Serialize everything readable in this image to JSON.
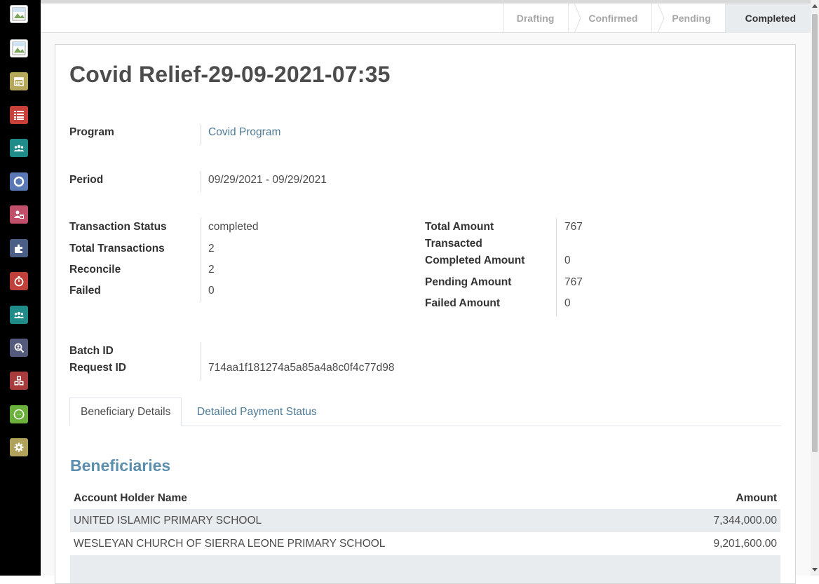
{
  "statusbar": {
    "stages": [
      "Drafting",
      "Confirmed",
      "Pending",
      "Completed"
    ],
    "active_stage": "Completed"
  },
  "sidebar": {
    "apps": [
      {
        "icon": "broken-image-icon",
        "color": "#ffffff"
      },
      {
        "icon": "broken-image-icon",
        "color": "#ffffff"
      },
      {
        "icon": "calendar-icon",
        "color": "#b6a85a"
      },
      {
        "icon": "list-icon",
        "color": "#c9403b"
      },
      {
        "icon": "users-icon",
        "color": "#1f8c8a"
      },
      {
        "icon": "lifebuoy-icon",
        "color": "#5a78b5"
      },
      {
        "icon": "user-calendar-icon",
        "color": "#c0506a"
      },
      {
        "icon": "puzzle-icon",
        "color": "#4b5f86"
      },
      {
        "icon": "stopwatch-icon",
        "color": "#c0403a"
      },
      {
        "icon": "users-icon",
        "color": "#1f8c8a"
      },
      {
        "icon": "search-user-icon",
        "color": "#545a7c"
      },
      {
        "icon": "cubes-icon",
        "color": "#a83b3b"
      },
      {
        "icon": "api-icon",
        "color": "#6ab03a"
      },
      {
        "icon": "gear-icon",
        "color": "#b0a25a"
      }
    ]
  },
  "record": {
    "title": "Covid Relief-29-09-2021-07:35",
    "program_label": "Program",
    "program_value": "Covid Program",
    "period_label": "Period",
    "period_value": "09/29/2021 - 09/29/2021",
    "left_fields": [
      {
        "label": "Transaction Status",
        "value": "completed"
      },
      {
        "label": "Total Transactions",
        "value": "2"
      },
      {
        "label": "Reconcile",
        "value": "2"
      },
      {
        "label": "Failed",
        "value": "0"
      }
    ],
    "right_fields": [
      {
        "label_line1": "Total Amount",
        "label_line2": "Transacted",
        "value": "767"
      },
      {
        "label": "Completed Amount",
        "value": "0"
      },
      {
        "label": "Pending Amount",
        "value": "767"
      },
      {
        "label": "Failed Amount",
        "value": "0"
      }
    ],
    "batch_id_label": "Batch ID",
    "batch_id_value": "",
    "request_id_label": "Request ID",
    "request_id_value": "714aa1f181274a5a85a4a8c0f4c77d98"
  },
  "tabs": [
    "Beneficiary Details",
    "Detailed Payment Status"
  ],
  "beneficiaries": {
    "title": "Beneficiaries",
    "columns": [
      "Account Holder Name",
      "Amount"
    ],
    "rows": [
      {
        "name": "UNITED ISLAMIC PRIMARY SCHOOL",
        "amount": "7,344,000.00"
      },
      {
        "name": "WESLEYAN CHURCH OF SIERRA LEONE PRIMARY SCHOOL",
        "amount": "9,201,600.00"
      }
    ]
  }
}
